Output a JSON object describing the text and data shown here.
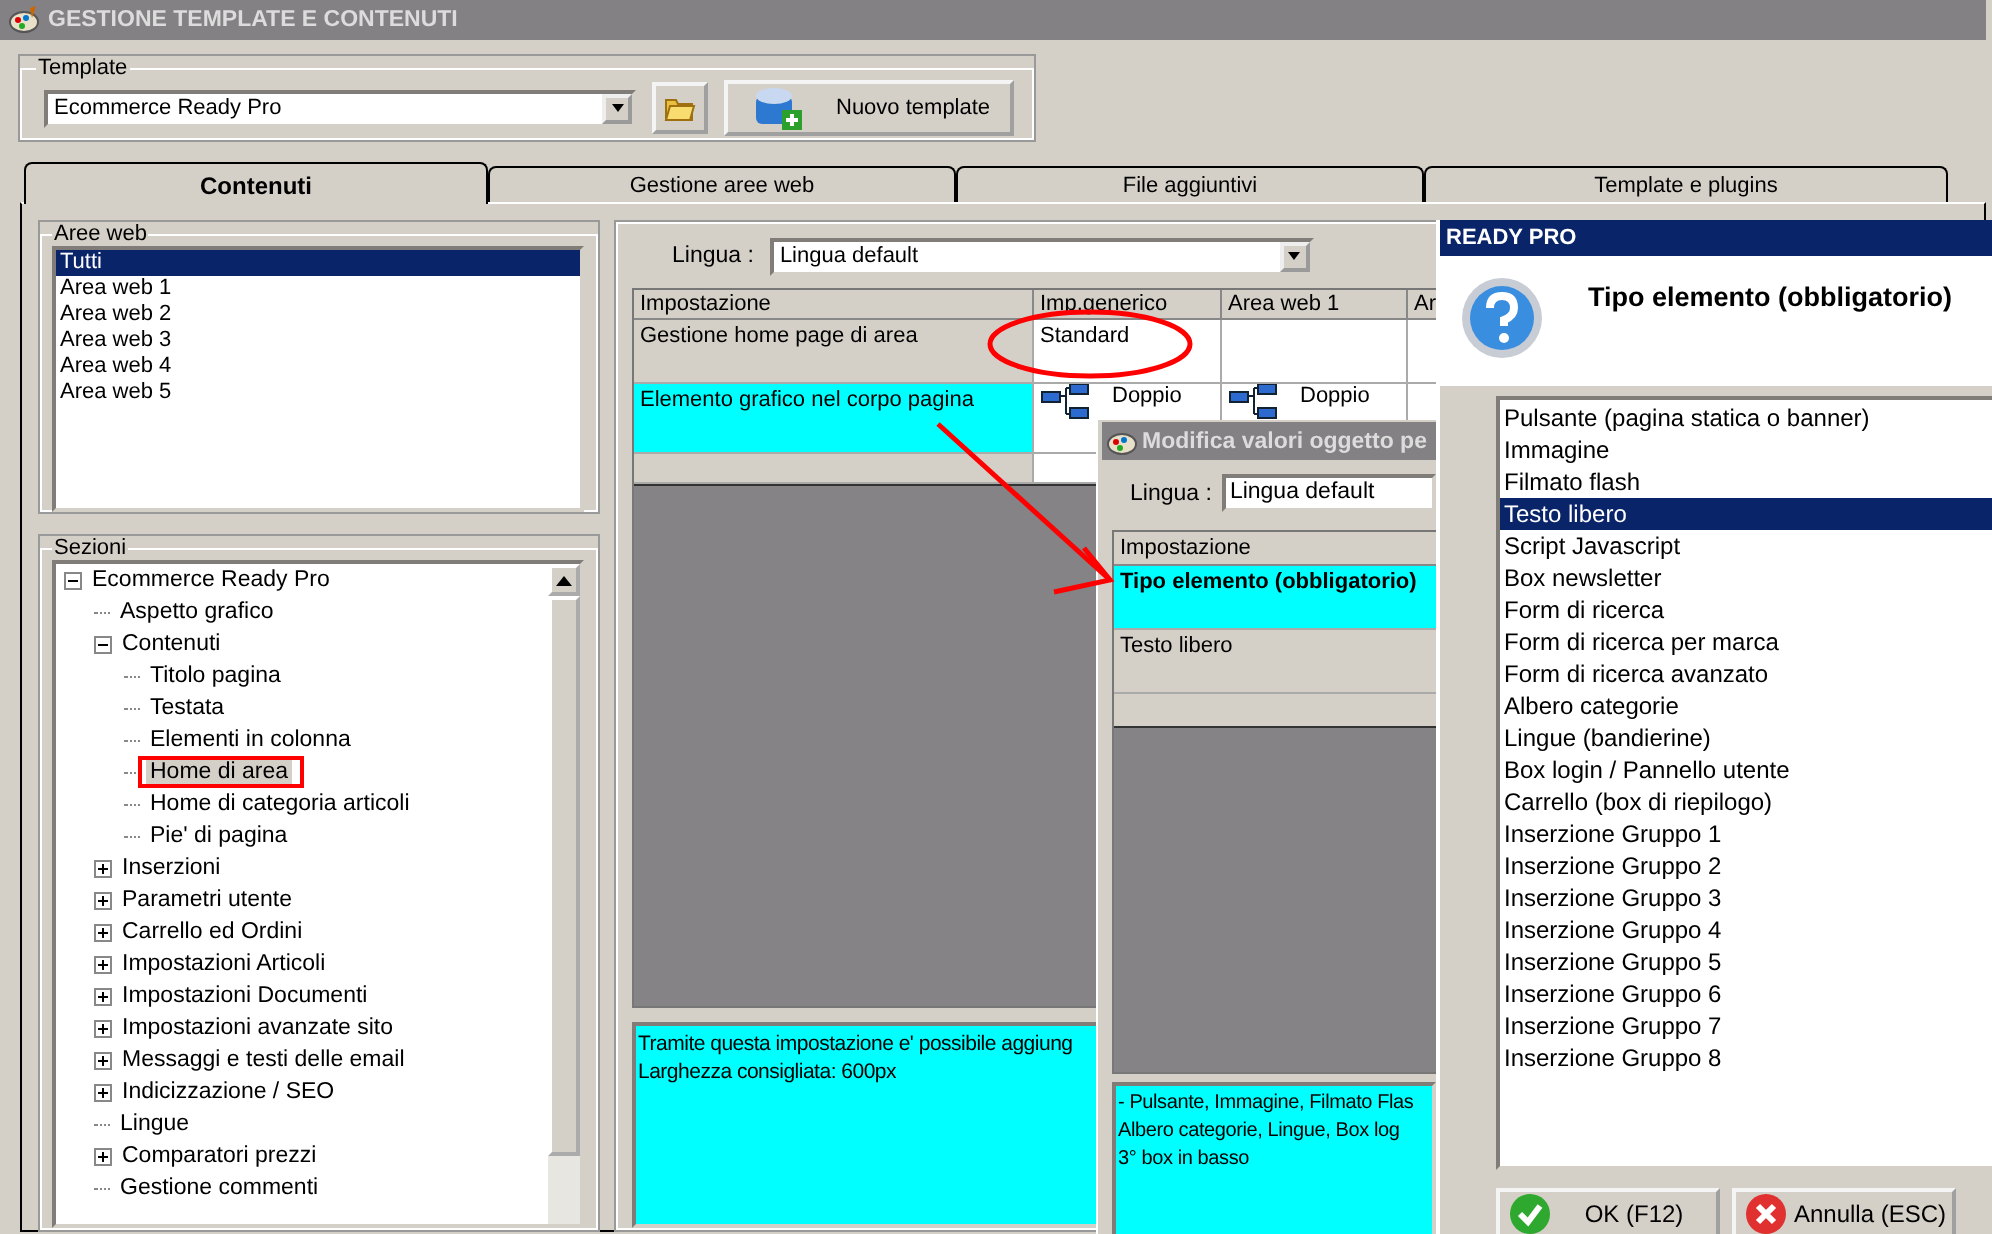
{
  "window": {
    "title": "GESTIONE TEMPLATE E CONTENUTI"
  },
  "template": {
    "label": "Template",
    "value": "Ecommerce Ready Pro",
    "new_button": "Nuovo template"
  },
  "tabs": [
    {
      "label": "Contenuti",
      "selected": true
    },
    {
      "label": "Gestione aree web",
      "selected": false
    },
    {
      "label": "File aggiuntivi",
      "selected": false
    },
    {
      "label": "Template e plugins",
      "selected": false
    }
  ],
  "aree_web": {
    "label": "Aree web",
    "items": [
      {
        "label": "Tutti",
        "selected": true
      },
      {
        "label": "Area web 1",
        "selected": false
      },
      {
        "label": "Area web 2",
        "selected": false
      },
      {
        "label": "Area web 3",
        "selected": false
      },
      {
        "label": "Area web 4",
        "selected": false
      },
      {
        "label": "Area web 5",
        "selected": false
      }
    ]
  },
  "sezioni": {
    "label": "Sezioni",
    "tree": [
      {
        "label": "Ecommerce Ready Pro",
        "expanded": true,
        "selected": false,
        "children": [
          {
            "label": "Aspetto grafico",
            "selected": false
          },
          {
            "label": "Contenuti",
            "expanded": true,
            "selected": false,
            "children": [
              {
                "label": "Titolo pagina",
                "selected": false
              },
              {
                "label": "Testata",
                "selected": false
              },
              {
                "label": "Elementi in colonna",
                "selected": false
              },
              {
                "label": "Home di area",
                "selected": true
              },
              {
                "label": "Home di categoria articoli",
                "selected": false
              },
              {
                "label": "Pie' di pagina",
                "selected": false
              }
            ]
          },
          {
            "label": "Inserzioni",
            "expanded": false,
            "selected": false
          },
          {
            "label": "Parametri utente",
            "expanded": false,
            "selected": false
          },
          {
            "label": "Carrello ed Ordini",
            "expanded": false,
            "selected": false
          },
          {
            "label": "Impostazioni Articoli",
            "expanded": false,
            "selected": false
          },
          {
            "label": "Impostazioni Documenti",
            "expanded": false,
            "selected": false
          },
          {
            "label": "Impostazioni avanzate sito",
            "expanded": false,
            "selected": false
          },
          {
            "label": "Messaggi e testi delle email",
            "expanded": false,
            "selected": false
          },
          {
            "label": "Indicizzazione / SEO",
            "expanded": false,
            "selected": false
          },
          {
            "label": "Lingue",
            "selected": false
          },
          {
            "label": "Comparatori prezzi",
            "expanded": false,
            "selected": false
          },
          {
            "label": "Gestione commenti",
            "selected": false
          }
        ]
      }
    ]
  },
  "lingua": {
    "label": "Lingua :",
    "value": "Lingua default"
  },
  "grid": {
    "columns": [
      "Impostazione",
      "Imp.generico",
      "Area web 1",
      "Ar"
    ],
    "rows": [
      {
        "setting": "Gestione home page di area",
        "selected": false,
        "kind": "text",
        "values": [
          "Standard"
        ]
      },
      {
        "setting": "Elemento grafico nel corpo pagina",
        "selected": true,
        "kind": "icon_text",
        "values": [
          "Doppio",
          "Doppio"
        ]
      }
    ]
  },
  "description": [
    "Tramite questa impostazione e' possibile aggiung",
    "Larghezza consigliata: 600px"
  ],
  "dialog_modifica": {
    "title": "Modifica valori oggetto pe",
    "lingua_label": "Lingua :",
    "lingua_value": "Lingua default",
    "column": "Impostazione",
    "rows": [
      {
        "text": "Tipo elemento (obbligatorio)",
        "selected": true
      },
      {
        "text": "Testo libero",
        "selected": false
      }
    ],
    "description": [
      "- Pulsante, Immagine, Filmato Flas",
      "Albero categorie, Lingue, Box log",
      "3° box in basso"
    ]
  },
  "dialog_ready": {
    "title": "READY PRO",
    "question": "Tipo elemento (obbligatorio)",
    "options": [
      {
        "label": "Pulsante (pagina statica o banner)",
        "selected": false
      },
      {
        "label": "Immagine",
        "selected": false
      },
      {
        "label": "Filmato flash",
        "selected": false
      },
      {
        "label": "Testo libero",
        "selected": true
      },
      {
        "label": "Script Javascript",
        "selected": false
      },
      {
        "label": "Box newsletter",
        "selected": false
      },
      {
        "label": "Form di ricerca",
        "selected": false
      },
      {
        "label": "Form di ricerca per marca",
        "selected": false
      },
      {
        "label": "Form di ricerca avanzato",
        "selected": false
      },
      {
        "label": "Albero categorie",
        "selected": false
      },
      {
        "label": "Lingue (bandierine)",
        "selected": false
      },
      {
        "label": "Box login / Pannello utente",
        "selected": false
      },
      {
        "label": "Carrello (box di riepilogo)",
        "selected": false
      },
      {
        "label": "Inserzione Gruppo 1",
        "selected": false
      },
      {
        "label": "Inserzione Gruppo 2",
        "selected": false
      },
      {
        "label": "Inserzione Gruppo 3",
        "selected": false
      },
      {
        "label": "Inserzione Gruppo 4",
        "selected": false
      },
      {
        "label": "Inserzione Gruppo 5",
        "selected": false
      },
      {
        "label": "Inserzione Gruppo 6",
        "selected": false
      },
      {
        "label": "Inserzione Gruppo 7",
        "selected": false
      },
      {
        "label": "Inserzione Gruppo 8",
        "selected": false
      }
    ],
    "buttons": [
      {
        "label": "OK (F12)",
        "kind": "ok"
      },
      {
        "label": "Annulla (ESC)",
        "kind": "cancel"
      }
    ]
  }
}
